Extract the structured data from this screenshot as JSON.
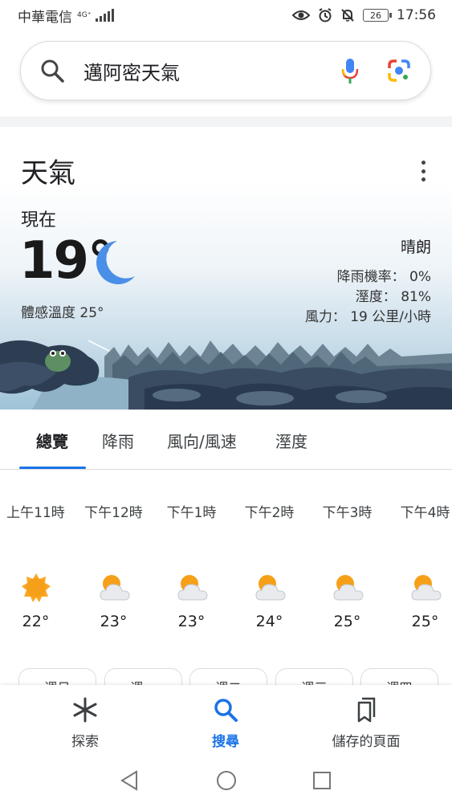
{
  "status_bar": {
    "carrier": "中華電信",
    "network": "4G⁺",
    "battery": "26",
    "time": "17:56"
  },
  "search": {
    "query": "邁阿密天氣"
  },
  "weather": {
    "title": "天氣",
    "now_label": "現在",
    "temperature": "19°",
    "feels_like": "體感溫度 25°",
    "condition": "晴朗",
    "precip": "降雨機率： 0%",
    "humidity": "溼度： 81%",
    "wind": "風力： 19 公里/小時"
  },
  "tabs": [
    {
      "label": "總覽",
      "active": true
    },
    {
      "label": "降雨",
      "active": false
    },
    {
      "label": "風向/風速",
      "active": false
    },
    {
      "label": "溼度",
      "active": false
    }
  ],
  "hourly": [
    {
      "time": "上午11時",
      "temp": "22°",
      "icon": "sun-icon"
    },
    {
      "time": "下午12時",
      "temp": "23°",
      "icon": "partly-cloudy-icon"
    },
    {
      "time": "下午1時",
      "temp": "23°",
      "icon": "partly-cloudy-icon"
    },
    {
      "time": "下午2時",
      "temp": "24°",
      "icon": "partly-cloudy-icon"
    },
    {
      "time": "下午3時",
      "temp": "25°",
      "icon": "partly-cloudy-icon"
    },
    {
      "time": "下午4時",
      "temp": "25°",
      "icon": "partly-cloudy-icon"
    }
  ],
  "day_chips": [
    "週日",
    "週一",
    "週二",
    "週三",
    "週四"
  ],
  "bottom_nav": {
    "discover": "探索",
    "search": "搜尋",
    "saved": "儲存的頁面"
  },
  "colors": {
    "accent": "#1a73e8",
    "moon": "#4a8fe7",
    "sun": "#f9a825"
  }
}
